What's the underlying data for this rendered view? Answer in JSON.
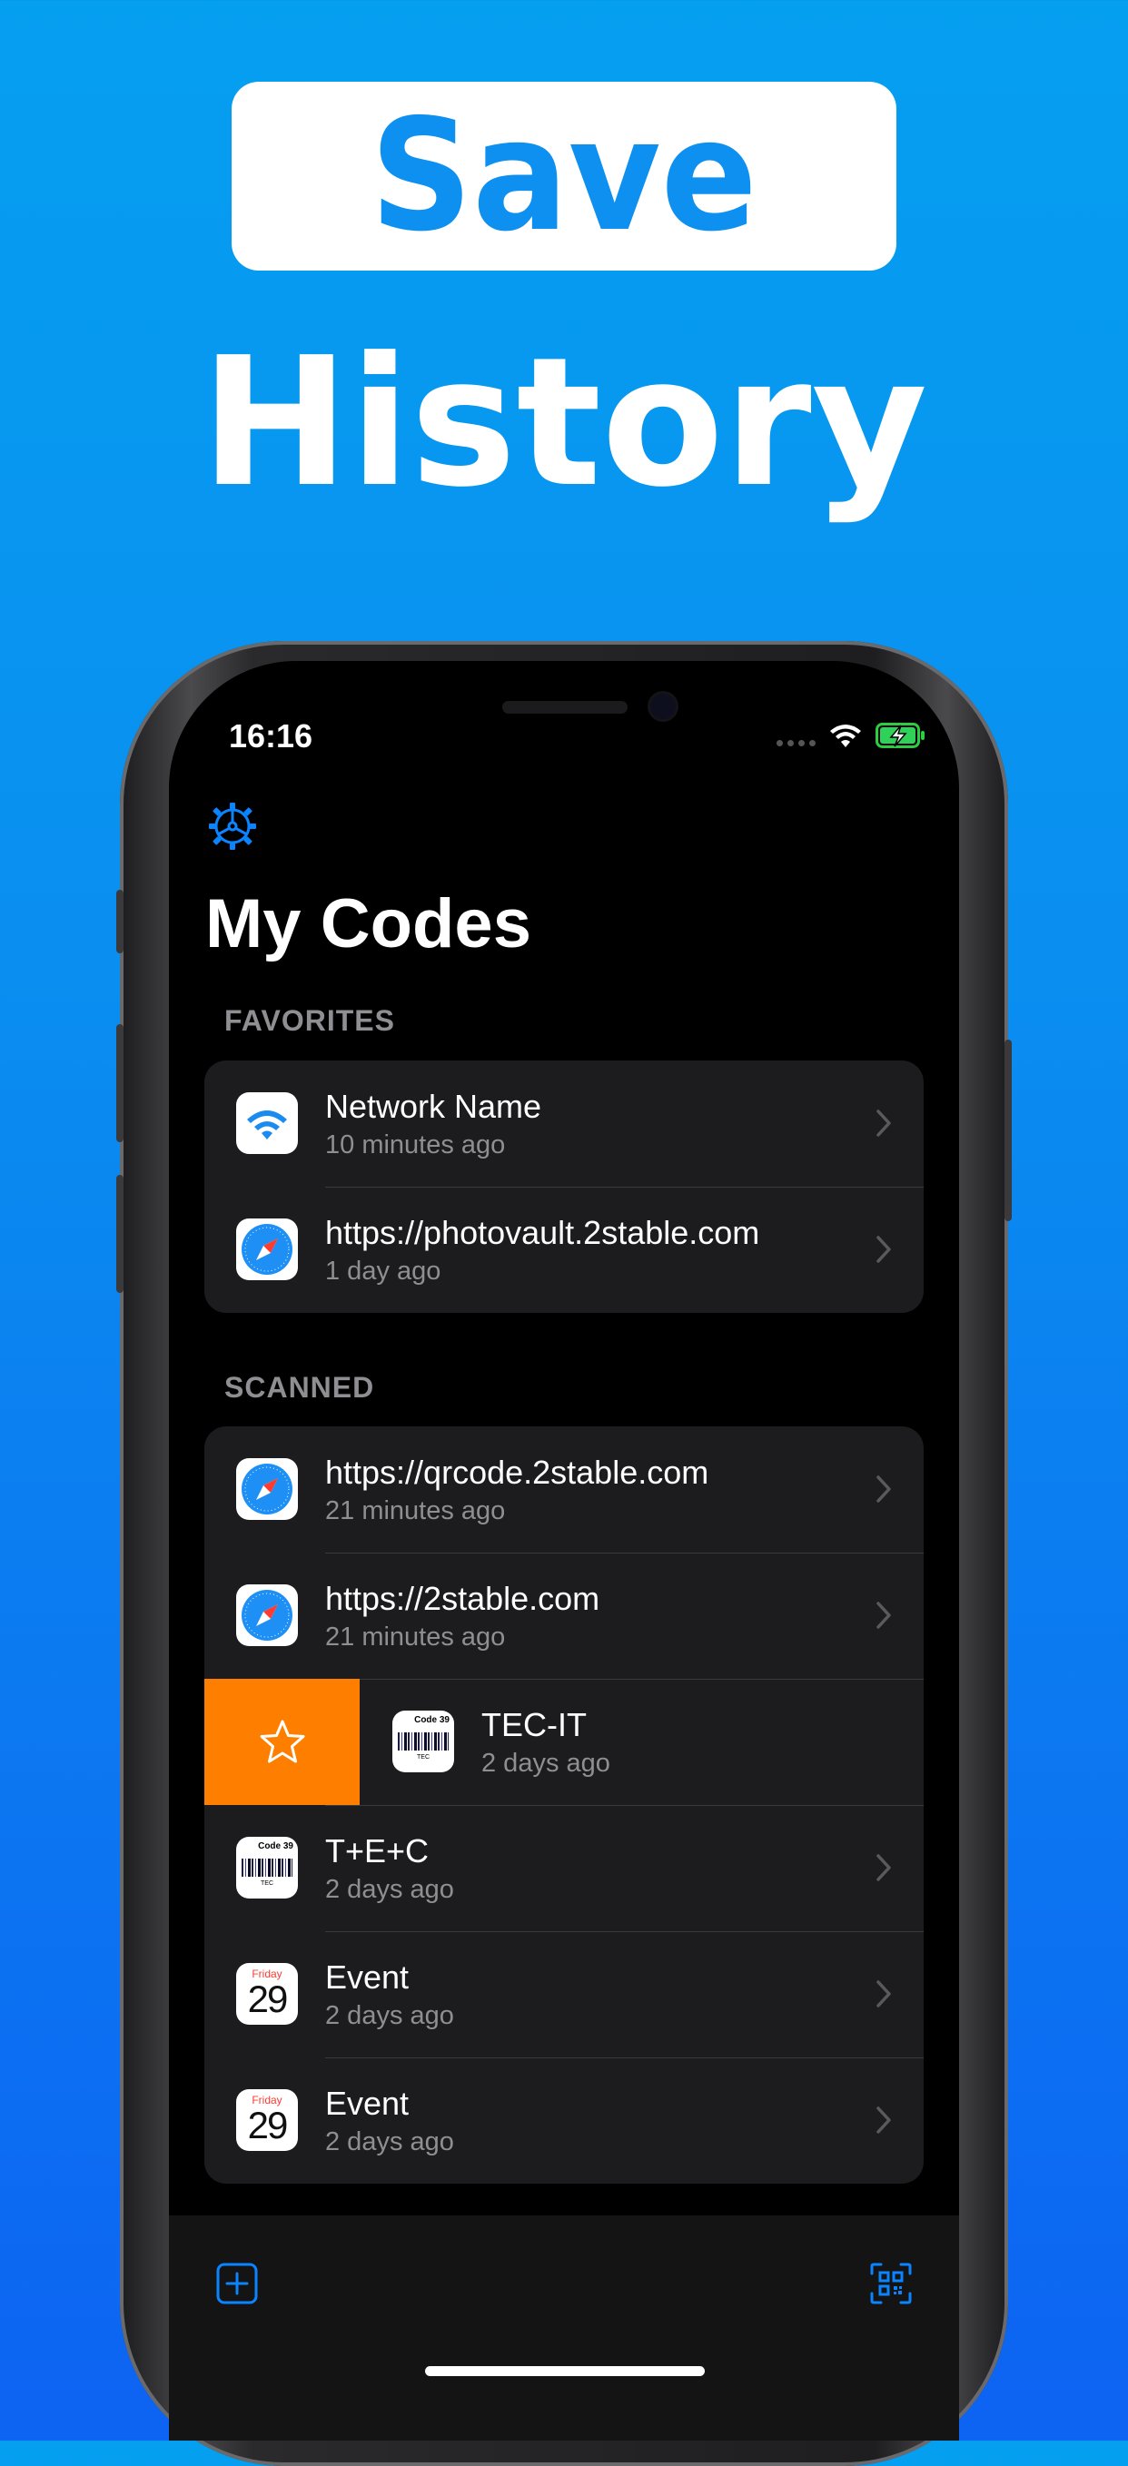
{
  "promo": {
    "headline": "Save",
    "subheadline": "History"
  },
  "status_bar": {
    "time": "16:16"
  },
  "screen": {
    "title": "My Codes",
    "sections": [
      {
        "header": "FAVORITES",
        "items": [
          {
            "icon": "wifi-icon",
            "title": "Network Name",
            "subtitle": "10 minutes ago"
          },
          {
            "icon": "safari-icon",
            "title": "https://photovault.2stable.com",
            "subtitle": "1 day ago"
          }
        ]
      },
      {
        "header": "SCANNED",
        "items": [
          {
            "icon": "safari-icon",
            "title": "https://qrcode.2stable.com",
            "subtitle": "21 minutes ago"
          },
          {
            "icon": "safari-icon",
            "title": "https://2stable.com",
            "subtitle": "21 minutes ago"
          },
          {
            "icon": "barcode-icon",
            "title": "TEC-IT",
            "subtitle": "2 days ago",
            "icon_label": "Code 39",
            "icon_text": "TEC",
            "swiped": true
          },
          {
            "icon": "barcode-icon",
            "title": "T+E+C",
            "subtitle": "2 days ago",
            "icon_label": "Code 39",
            "icon_text": "TEC"
          },
          {
            "icon": "calendar-icon",
            "title": "Event",
            "subtitle": "2 days ago",
            "icon_label": "Friday",
            "icon_text": "29"
          },
          {
            "icon": "calendar-icon",
            "title": "Event",
            "subtitle": "2 days ago",
            "icon_label": "Friday",
            "icon_text": "29"
          }
        ]
      }
    ]
  },
  "colors": {
    "accent": "#0a84ff",
    "favorite_action": "#fe7f00",
    "row_bg": "#1c1c1e"
  }
}
